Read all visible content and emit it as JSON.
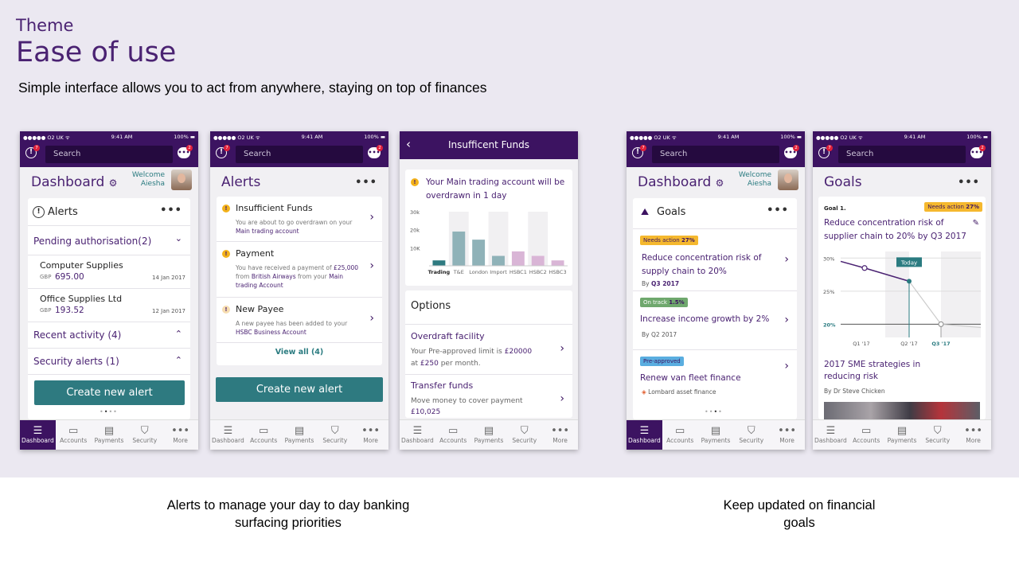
{
  "theme": "Theme",
  "title": "Ease of use",
  "subtitle": "Simple interface allows you to act from anywhere, staying on top of finances",
  "caption_left": [
    "Alerts to manage your day to day banking",
    "surfacing priorities"
  ],
  "caption_right": [
    "Keep updated on financial",
    "goals"
  ],
  "status": {
    "carrier": "●●●●● O2 UK ᯤ",
    "time": "9:41 AM",
    "battery": "100% ▬"
  },
  "search_placeholder": "Search",
  "alert_badge": "7",
  "chat_badge": "2",
  "tabs": [
    "Dashboard",
    "Accounts",
    "Payments",
    "Security",
    "More"
  ],
  "tab_icons": [
    "☰",
    "▭",
    "▤",
    "⛉",
    "•••"
  ],
  "phone1": {
    "title": "Dashboard",
    "welcome": "Welcome",
    "name": "Aiesha",
    "card_title": "Alerts",
    "pending": "Pending authorisation(2)",
    "items": [
      {
        "name": "Computer Supplies",
        "cur": "GBP",
        "amount": "695.00",
        "date": "14 Jan 2017"
      },
      {
        "name": "Office Supplies Ltd",
        "cur": "GBP",
        "amount": "193.52",
        "date": "12 Jan 2017"
      }
    ],
    "recent": "Recent activity (4)",
    "security": "Security alerts (1)",
    "button": "Create new alert"
  },
  "phone2": {
    "title": "Alerts",
    "alerts": [
      {
        "title": "Insufficient Funds",
        "body": "You are about to go overdrawn on your",
        "link": "Main trading account"
      },
      {
        "title": "Payment",
        "body1": "You have received a payment of",
        "amount": "£25,000",
        "from": "from",
        "payer": "British Airways",
        "body2": "from your",
        "link1": "Main",
        "link2": "trading Account"
      },
      {
        "title": "New Payee",
        "body": "A new payee has been added to your",
        "link": "HSBC Business Account"
      }
    ],
    "view_all": "View all (4)",
    "button": "Create new alert"
  },
  "phone3": {
    "title": "Insufficent Funds",
    "message": "Your Main trading account will be overdrawn in 1 day",
    "options": "Options",
    "overdraft": {
      "title": "Overdraft facility",
      "line1": "Your Pre-approved limit is",
      "limit": "£20000",
      "at": "at",
      "rate": "£250",
      "per": "per month."
    },
    "transfer": {
      "title": "Transfer funds",
      "line1": "Move money to cover payment",
      "amount": "£10,025"
    }
  },
  "phone4": {
    "title": "Dashboard",
    "welcome": "Welcome",
    "name": "Aiesha",
    "card_title": "Goals",
    "goals": [
      {
        "tag": "Needs action",
        "pct": "27%",
        "title": "Reduce concentration risk of supply chain to 20%",
        "by": "By",
        "when": "Q3 2017",
        "tag_color": "#f5b82e"
      },
      {
        "tag": "On track",
        "pct": "1.5%",
        "title": "Increase income growth by 2%",
        "by": "By Q2 2017",
        "when": "",
        "tag_color": "#6fa86d"
      },
      {
        "tag": "Pre-approved",
        "pct": "",
        "title": "Renew van fleet finance",
        "by": "Lombard asset finance",
        "when": "",
        "tag_color": "#5aaee0"
      }
    ]
  },
  "phone5": {
    "title": "Goals",
    "goal_label": "Goal 1.",
    "tag": "Needs action",
    "pct": "27%",
    "goal_title": "Reduce concentration risk of supplier chain to 20% by Q3 2017",
    "today": "Today",
    "yticks": [
      "30%",
      "25%",
      "20%"
    ],
    "xticks": [
      "Q1 '17",
      "Q2 '17",
      "Q3 '17"
    ],
    "article_title": "2017 SME strategies in reducing risk",
    "author": "By Dr Steve Chicken"
  },
  "chart_data": [
    {
      "type": "bar",
      "categories": [
        "Trading",
        "T&E",
        "London",
        "Import",
        "HSBC1",
        "HSBC2",
        "HSBC3"
      ],
      "values": [
        3000,
        19000,
        14500,
        5500,
        8000,
        5500,
        3000
      ],
      "yticks": [
        "30k",
        "20k",
        "10K"
      ],
      "ylim": [
        0,
        30000
      ],
      "colors": [
        "#2e7a80",
        "#8fb2b8",
        "#8fb2b8",
        "#8fb2b8",
        "#d9b5d6",
        "#d9b5d6",
        "#d9b5d6"
      ]
    },
    {
      "type": "line",
      "x": [
        "Q1 '17",
        "Q2 '17",
        "Q3 '17"
      ],
      "series": [
        {
          "values": [
            28.5,
            26.5,
            20
          ]
        }
      ],
      "ylim": [
        18,
        31
      ]
    }
  ]
}
